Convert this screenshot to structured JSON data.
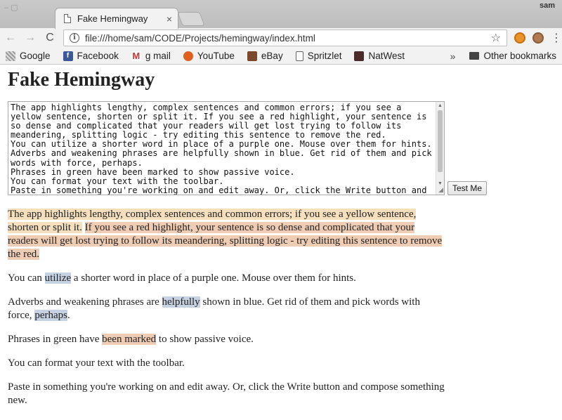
{
  "browser": {
    "tab_title": "Fake Hemingway",
    "tab_close": "×",
    "user_label": "sam",
    "url": "file:///home/sam/CODE/Projects/hemingway/index.html",
    "nav": {
      "back": "←",
      "forward": "→",
      "reload": "C"
    },
    "star": "☆",
    "menu": "⋮",
    "bookmarks": [
      {
        "label": "Google",
        "icon": "grid-icon"
      },
      {
        "label": "Facebook",
        "icon": "facebook-icon"
      },
      {
        "label": "g mail",
        "icon": "gmail-icon"
      },
      {
        "label": "YouTube",
        "icon": "youtube-icon"
      },
      {
        "label": "eBay",
        "icon": "ebay-icon"
      },
      {
        "label": "Spritzlet",
        "icon": "document-icon"
      },
      {
        "label": "NatWest",
        "icon": "natwest-icon"
      }
    ],
    "overflow": "»",
    "other_bookmarks": "Other bookmarks"
  },
  "page": {
    "title": "Fake Hemingway",
    "editor_text": "The app highlights lengthy, complex sentences and common errors; if you see a yellow sentence, shorten or split it. If you see a red highlight, your sentence is so dense and complicated that your readers will get lost trying to follow its meandering, splitting logic - try editing this sentence to remove the red.\nYou can utilize a shorter word in place of a purple one. Mouse over them for hints.\nAdverbs and weakening phrases are helpfully shown in blue. Get rid of them and pick words with force, perhaps.\nPhrases in green have been marked to show passive voice.\nYou can format your text with the toolbar.\nPaste in something you're working on and edit away. Or, click the Write button and compose something new.",
    "test_button": "Test Me",
    "output": {
      "p1": {
        "yellow": "The app highlights lengthy, complex sentences and common errors; if you see a yellow sentence, shorten or split it.",
        "space": " ",
        "red": "If you see a red highlight, your sentence is so dense and complicated that your readers will get lost trying to follow its meandering, splitting logic - try editing this sentence to remove the red."
      },
      "p2": {
        "before": "You can ",
        "hl": "utilize",
        "after": " a shorter word in place of a purple one. Mouse over them for hints."
      },
      "p3": {
        "before": "Adverbs and weakening phrases are ",
        "hl1": "helpfully",
        "middle": " shown in blue. Get rid of them and pick words with force, ",
        "hl2": "perhaps",
        "after": "."
      },
      "p4": {
        "before": "Phrases in green have ",
        "hl": "been marked",
        "after": " to show passive voice."
      },
      "p5": "You can format your text with the toolbar.",
      "p6": "Paste in something you're working on and edit away. Or, click the Write button and compose something new."
    }
  },
  "colors": {
    "highlight_red": "#efcdb4",
    "highlight_yellow": "#f5dfbd",
    "highlight_purple": "#c6d2e2",
    "highlight_blue": "#c6d2e2",
    "highlight_green": "#efcdb4"
  }
}
